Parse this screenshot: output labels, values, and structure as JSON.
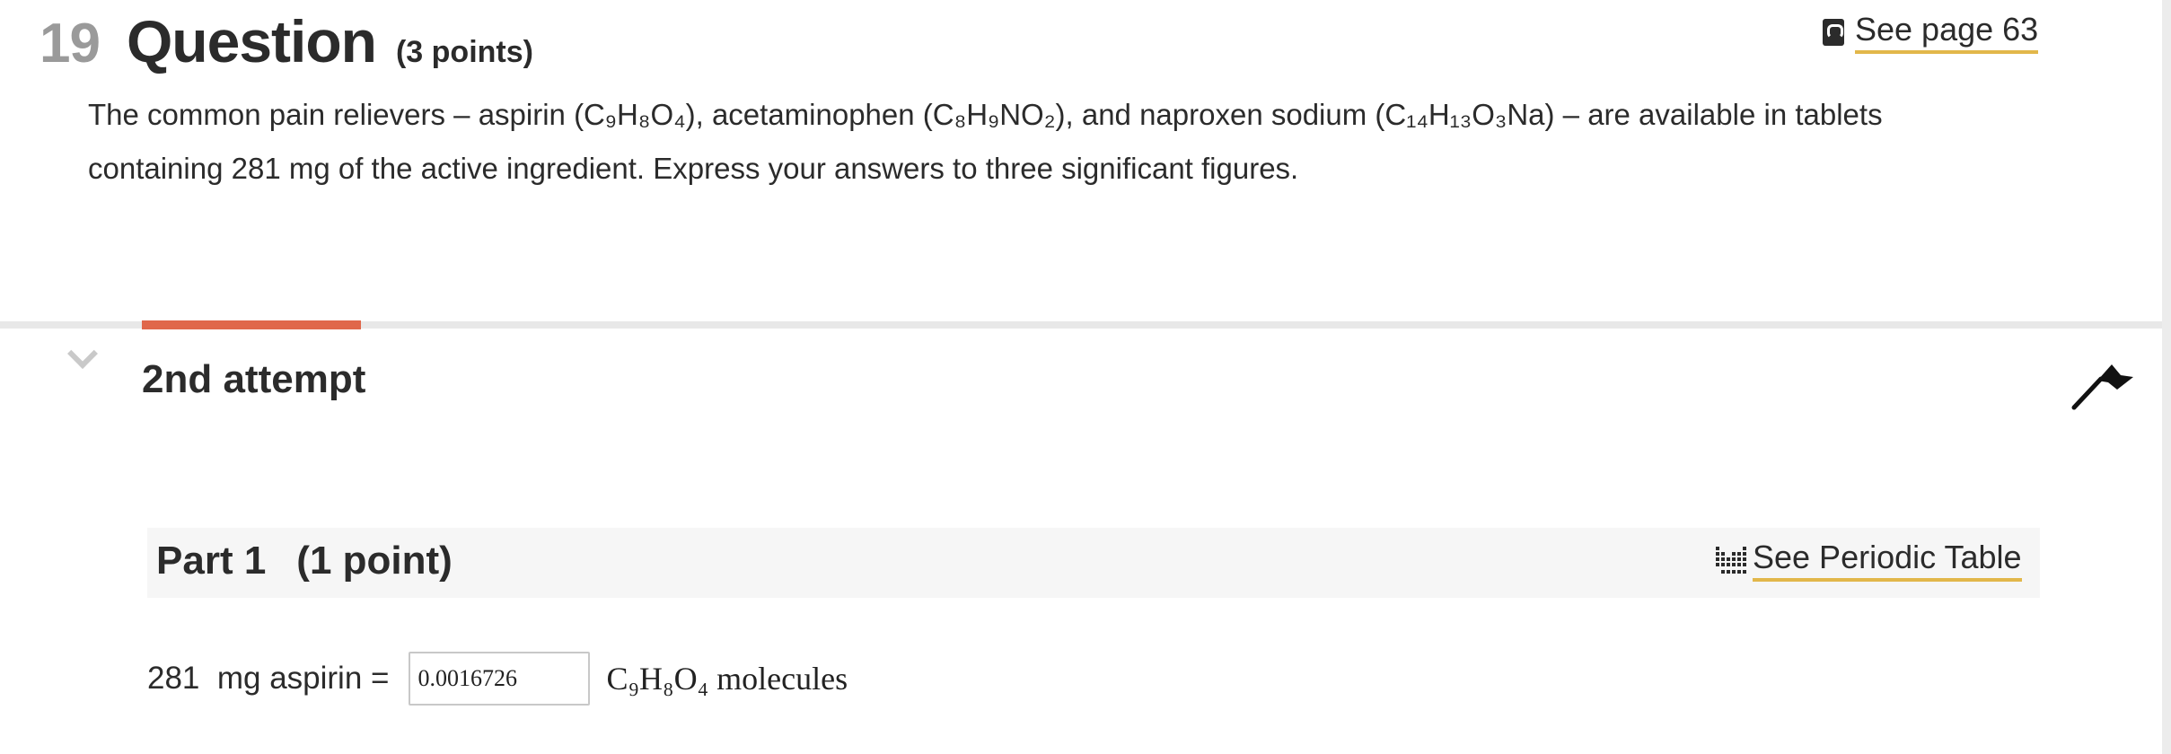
{
  "question": {
    "number": "19",
    "title": "Question",
    "points": "(3 points)",
    "see_page": "See page 63",
    "text_line1": "The common pain relievers – aspirin (C₉H₈O₄), acetaminophen (C₈H₉NO₂), and naproxen sodium (C₁₄H₁₃O₃Na) – are available in tablets",
    "text_line2": "containing 281 mg of the active ingredient.  Express your answers to three significant figures."
  },
  "attempt": {
    "label": "2nd attempt"
  },
  "part": {
    "title": "Part 1",
    "points": "(1 point)",
    "periodic_link": "See Periodic Table",
    "answer_label": "281  mg aspirin =",
    "answer_value": "0.0016726",
    "answer_unit": "C₉H₈O₄ molecules"
  },
  "colors": {
    "accent": "#e0674a",
    "link_underline": "#e2b74a",
    "divider": "#e8e8e8"
  },
  "icons": [
    "book-icon",
    "chevron-down-icon",
    "flag-icon",
    "periodic-table-icon"
  ]
}
